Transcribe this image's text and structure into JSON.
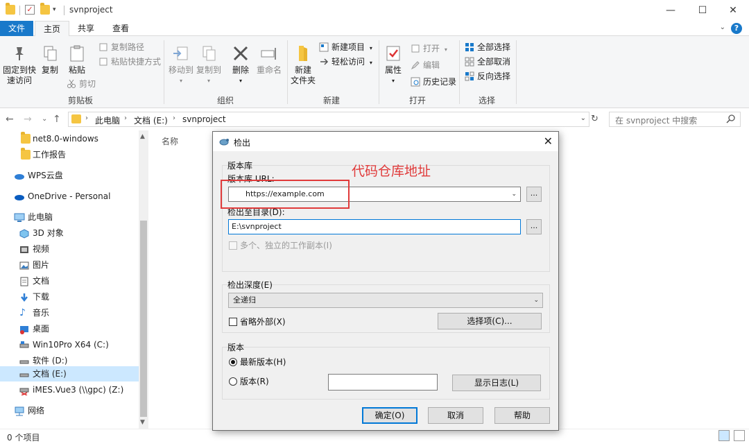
{
  "window": {
    "title": "svnproject",
    "min_glyph": "—",
    "max_glyph": "☐",
    "close_glyph": "✕"
  },
  "ribbon_tabs": [
    {
      "label": "文件"
    },
    {
      "label": "主页"
    },
    {
      "label": "共享"
    },
    {
      "label": "查看"
    }
  ],
  "ribbon": {
    "clipboard": {
      "pin_label_1": "固定到快",
      "pin_label_2": "速访问",
      "copy": "复制",
      "paste": "粘贴",
      "copy_path": "复制路径",
      "paste_shortcut": "粘贴快捷方式",
      "cut": "剪切",
      "group": "剪贴板"
    },
    "organize": {
      "move_to": "移动到",
      "copy_to": "复制到",
      "delete": "删除",
      "rename": "重命名",
      "group": "组织"
    },
    "new": {
      "new_folder_1": "新建",
      "new_folder_2": "文件夹",
      "new_item": "新建项目",
      "easy_access": "轻松访问",
      "group": "新建"
    },
    "open": {
      "properties": "属性",
      "open": "打开",
      "edit": "编辑",
      "history": "历史记录",
      "group": "打开"
    },
    "select": {
      "select_all": "全部选择",
      "select_none": "全部取消",
      "invert": "反向选择",
      "group": "选择"
    }
  },
  "address": {
    "crumbs": [
      "此电脑",
      "文档 (E:)",
      "svnproject"
    ],
    "search_placeholder": "在 svnproject 中搜索"
  },
  "nav_items": [
    {
      "label": "net8.0-windows",
      "icon": "folder-icon"
    },
    {
      "label": "工作报告",
      "icon": "folder-icon"
    },
    {
      "label": "WPS云盘",
      "icon": "cloud-icon"
    },
    {
      "label": "OneDrive - Personal",
      "icon": "cloud-icon"
    },
    {
      "label": "此电脑",
      "icon": "computer-icon"
    },
    {
      "label": "3D 对象",
      "icon": "cube-icon"
    },
    {
      "label": "视频",
      "icon": "video-icon"
    },
    {
      "label": "图片",
      "icon": "picture-icon"
    },
    {
      "label": "文档",
      "icon": "document-icon"
    },
    {
      "label": "下载",
      "icon": "download-icon"
    },
    {
      "label": "音乐",
      "icon": "music-icon"
    },
    {
      "label": "桌面",
      "icon": "desktop-icon"
    },
    {
      "label": "Win10Pro X64 (C:)",
      "icon": "drive-icon"
    },
    {
      "label": "软件 (D:)",
      "icon": "drive-icon"
    },
    {
      "label": "文档 (E:)",
      "icon": "drive-icon"
    },
    {
      "label": "iMES.Vue3 (\\\\gpc) (Z:)",
      "icon": "network-drive-icon"
    },
    {
      "label": "网络",
      "icon": "network-icon"
    }
  ],
  "content": {
    "column_name": "名称"
  },
  "status": {
    "items": "0 个项目"
  },
  "dialog": {
    "title": "检出",
    "repo_group": "版本库",
    "repo_url_label": "版本库 URL:",
    "repo_url_value": "https://example.com",
    "checkout_dir_label": "检出至目录(D):",
    "checkout_dir_value": "E:\\svnproject",
    "browse": "...",
    "multi_wc": "多个、独立的工作副本(I)",
    "depth_label": "检出深度(E)",
    "depth_value": "全递归",
    "omit_externals": "省略外部(X)",
    "options": "选择项(C)...",
    "revision_group": "版本",
    "head_revision": "最新版本(H)",
    "revision": "版本(R)",
    "show_log": "显示日志(L)",
    "ok": "确定(O)",
    "cancel": "取消",
    "help": "帮助"
  },
  "annotation": {
    "text": "代码仓库地址",
    "color": "#e03a3a"
  },
  "colors": {
    "file_tab": "#1979ca",
    "selection": "#cce8ff",
    "focus": "#0078d7"
  }
}
